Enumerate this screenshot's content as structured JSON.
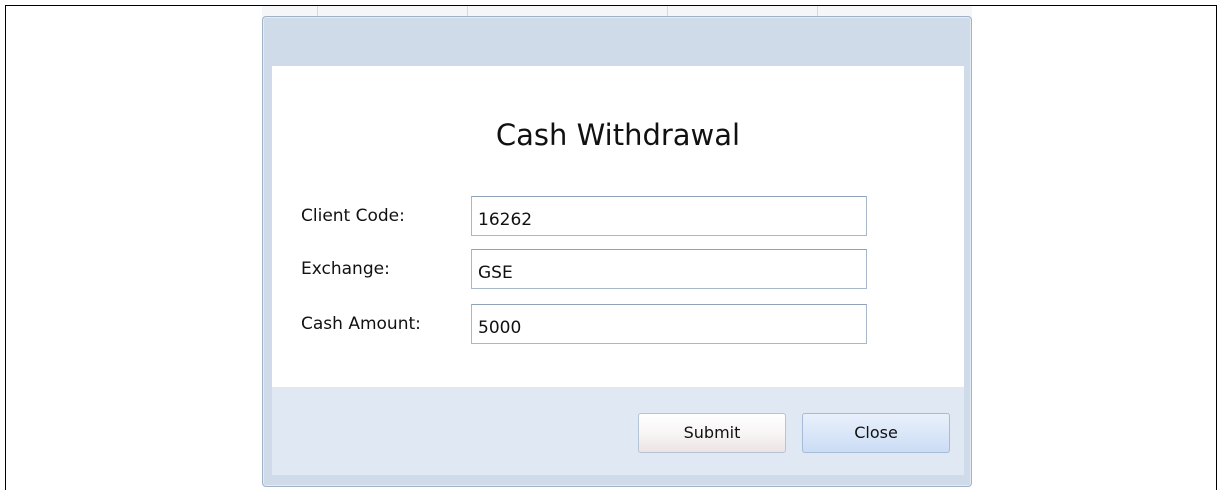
{
  "dialog": {
    "title": "Cash Withdrawal",
    "fields": [
      {
        "label": "Client Code:",
        "value": "16262"
      },
      {
        "label": "Exchange:",
        "value": "GSE"
      },
      {
        "label": "Cash Amount:",
        "value": "5000"
      }
    ],
    "buttons": {
      "submit_label": "Submit",
      "close_label": "Close"
    }
  },
  "colors": {
    "dialog_frame": "#cfdbe8",
    "footer": "#dfe8f3",
    "close_button": "#d9e6f8"
  }
}
